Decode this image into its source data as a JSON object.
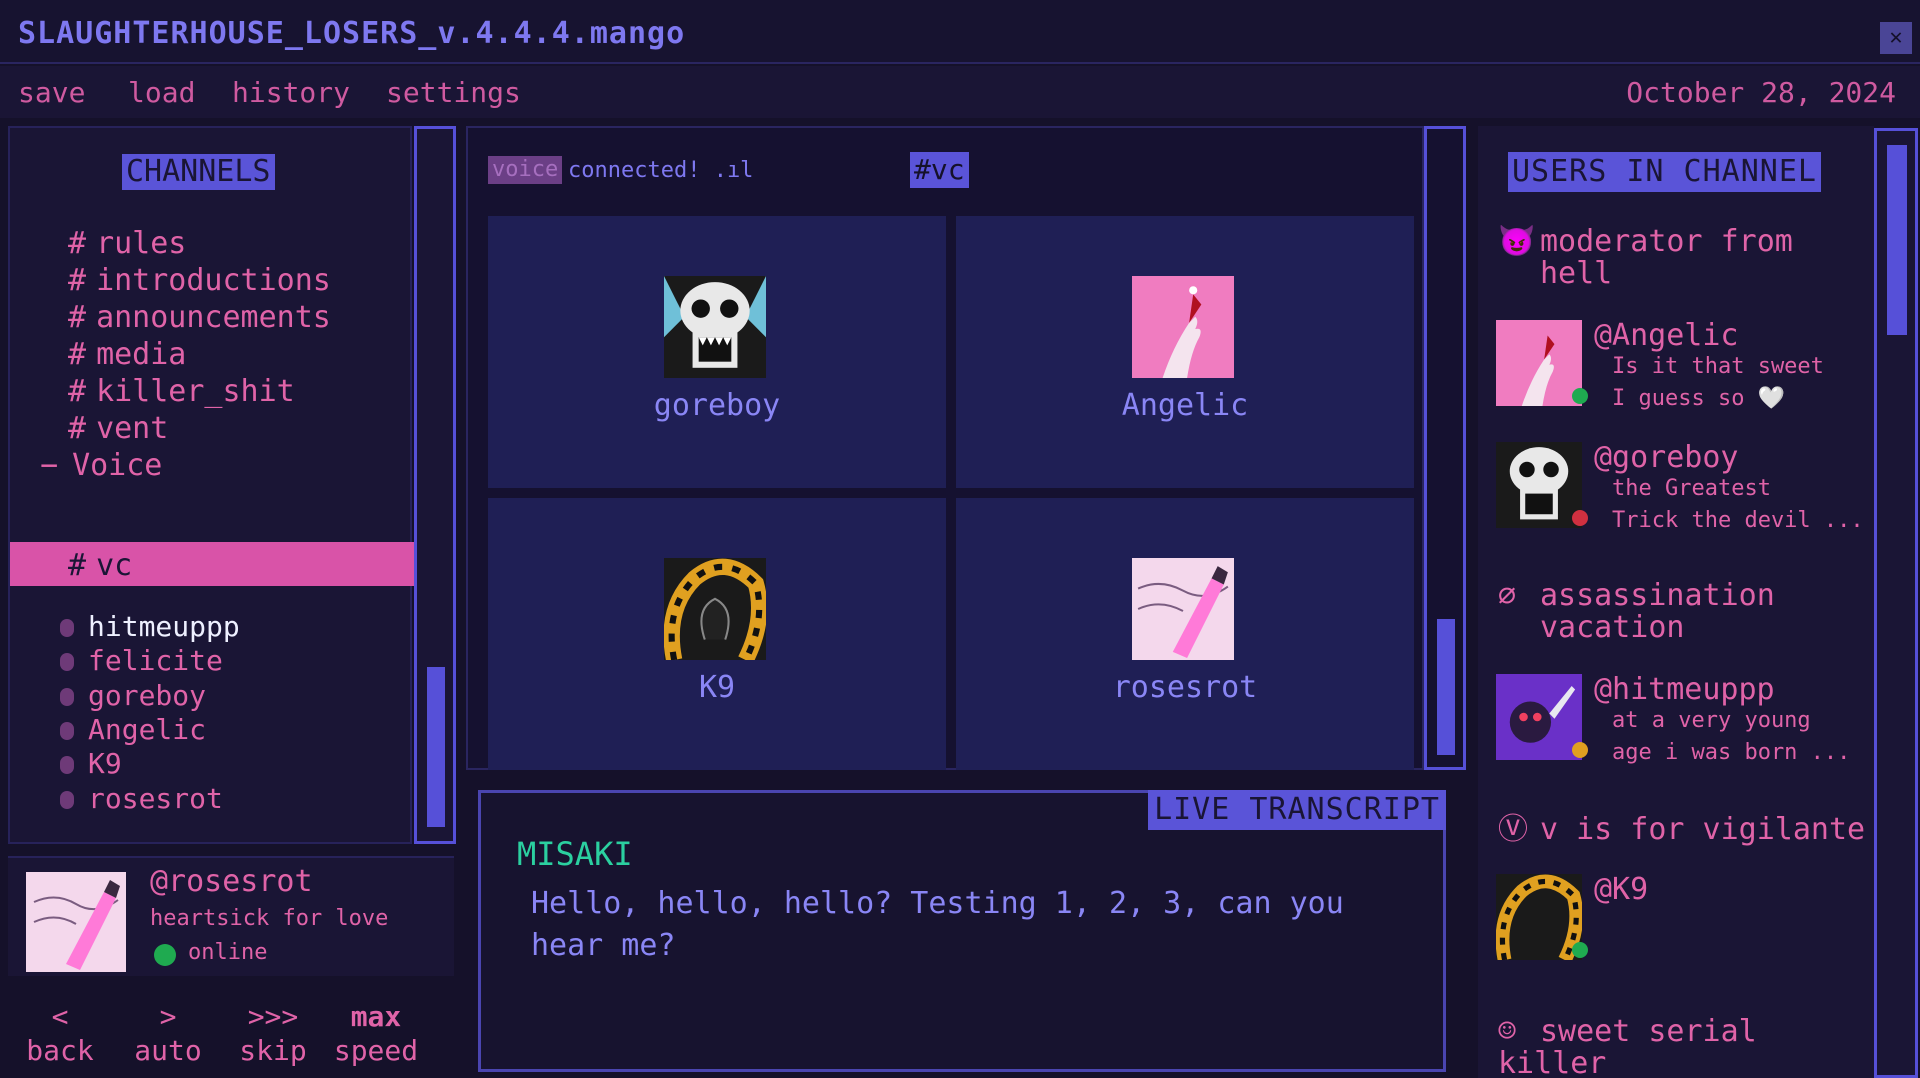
{
  "app": {
    "title": "SLAUGHTERHOUSE_LOSERS_v.4.4.4.mango",
    "close_label": "✕"
  },
  "menu": {
    "items": [
      "save",
      "load",
      "history",
      "settings"
    ],
    "date": "October 28, 2024"
  },
  "channels": {
    "heading": "CHANNELS",
    "text": [
      "rules",
      "introductions",
      "announcements",
      "media",
      "killer_shit",
      "vent"
    ],
    "voice_group": "Voice",
    "active": "vc",
    "voice_users": [
      "hitmeuppp",
      "felicite",
      "goreboy",
      "Angelic",
      "K9",
      "rosesrot"
    ]
  },
  "profile": {
    "handle": "@rosesrot",
    "status": "heartsick for love",
    "presence": "online"
  },
  "controls": [
    {
      "sym": "<",
      "label": "back"
    },
    {
      "sym": ">",
      "label": "auto"
    },
    {
      "sym": ">>>",
      "label": "skip"
    },
    {
      "sym": "max",
      "label": "speed"
    }
  ],
  "call": {
    "voice_tag": "voice",
    "connected": "connected! .ıl",
    "channel_tag": "#vc",
    "participants": [
      "goreboy",
      "Angelic",
      "K9",
      "rosesrot"
    ]
  },
  "transcript": {
    "heading": "LIVE TRANSCRIPT",
    "speaker": "MISAKI",
    "text": "Hello, hello, hello? Testing 1, 2, 3, can you hear me?"
  },
  "users": {
    "heading": "USERS IN CHANNEL",
    "roles": [
      {
        "icon": "devil-icon",
        "label": "moderator from",
        "label2": "hell"
      },
      {
        "icon": "null-icon",
        "label": "assassination",
        "label2": "vacation"
      },
      {
        "icon": "v-icon",
        "label": "v is for vigilante"
      },
      {
        "icon": "smiley-icon",
        "label": "sweet serial killer"
      }
    ],
    "members": [
      {
        "handle": "@Angelic",
        "line1": "Is it that sweet",
        "line2": "I guess so 🤍",
        "presence_color": "#1faa50"
      },
      {
        "handle": "@goreboy",
        "line1": "the Greatest",
        "line2": "Trick the devil ...",
        "presence_color": "#d03040"
      },
      {
        "handle": "@hitmeuppp",
        "line1": "at a very young",
        "line2": "age i was born ...",
        "presence_color": "#e0a020"
      },
      {
        "handle": "@K9",
        "presence_color": "#1faa50"
      }
    ]
  }
}
